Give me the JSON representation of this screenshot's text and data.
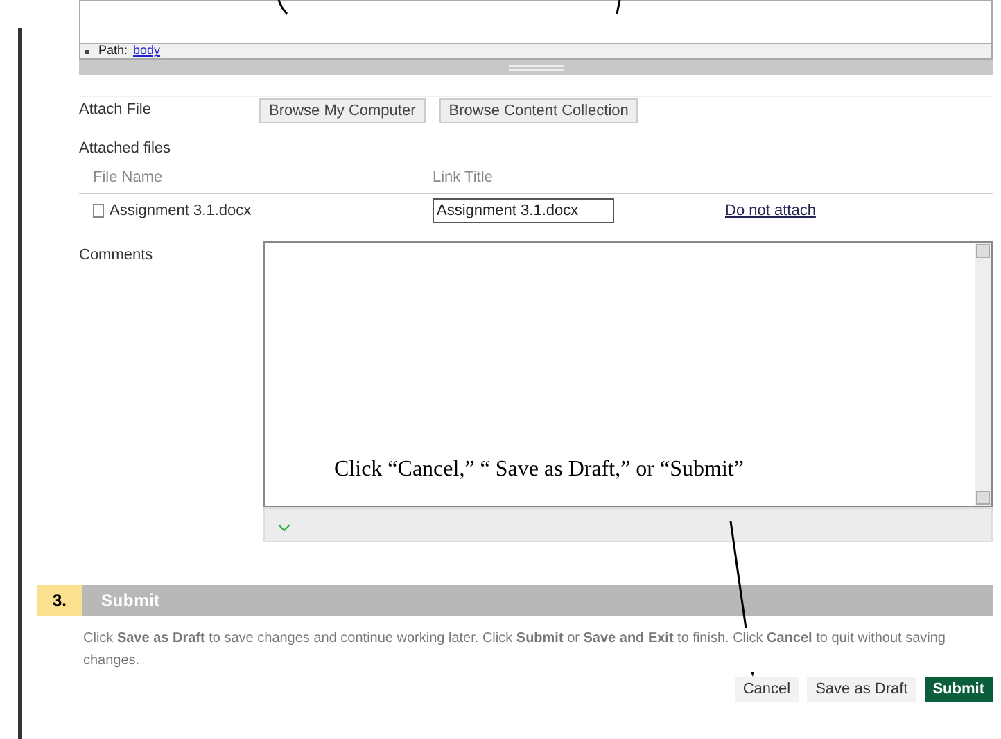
{
  "editor": {
    "path_label": "Path:",
    "path_link": "body"
  },
  "attach": {
    "label": "Attach File",
    "buttons": [
      "Browse My Computer",
      "Browse Content Collection"
    ]
  },
  "attached_files": {
    "title": "Attached files",
    "columns": [
      "File Name",
      "Link Title"
    ],
    "rows": [
      {
        "file_name": "Assignment 3.1.docx",
        "link_title": "Assignment 3.1.docx",
        "action": "Do not attach"
      }
    ]
  },
  "comments": {
    "label": "Comments"
  },
  "annotation": {
    "text": "Click “Cancel,” “ Save as Draft,” or “Submit”"
  },
  "section": {
    "number": "3.",
    "title": "Submit",
    "description": "Click **Save as Draft** to save changes and continue working later. Click **Submit** or **Save and Exit** to finish. Click **Cancel** to quit without saving changes."
  },
  "actions": [
    {
      "label": "Cancel",
      "kind": "plain"
    },
    {
      "label": "Save as Draft",
      "kind": "plain"
    },
    {
      "label": "Submit",
      "kind": "primary"
    }
  ]
}
